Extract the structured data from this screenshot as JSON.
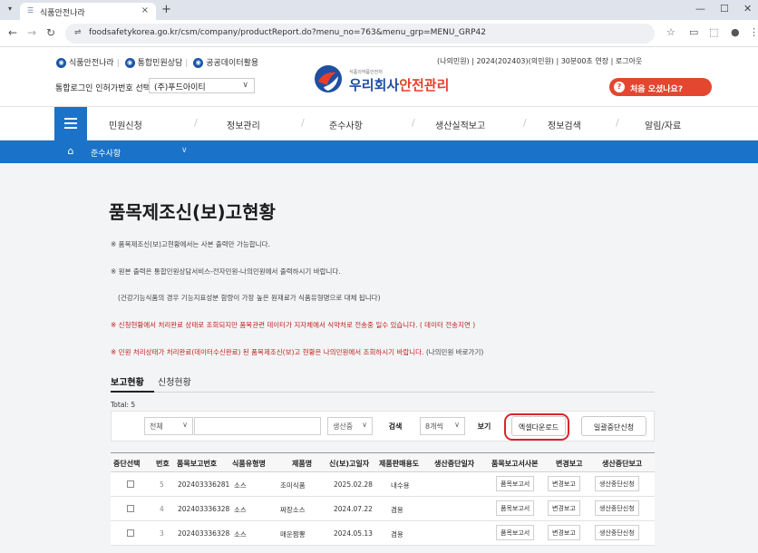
{
  "browser": {
    "tab_title": "식품안전나라",
    "tab_close": "×",
    "new_tab": "+",
    "menu_glyph": "▾",
    "url": "foodsafetykorea.go.kr/csm/company/productReport.do?menu_no=763&menu_grp=MENU_GRP42",
    "minimize": "—",
    "maximize": "☐",
    "close": "✕"
  },
  "header": {
    "quick_links": [
      "식품안전나라",
      "통합민원상담",
      "공공데이터활용"
    ],
    "login_label": "통합로그인 인허가번호 선택",
    "company": "(주)푸드아이티",
    "logo_small": "식품의약품안전처",
    "logo_main_a": "우리회사",
    "logo_main_b": "안전관리",
    "user_info": "(나의민원) | 2024(202403)(의민원) | 30분00초 연장 | 로그아웃",
    "help_button": "처음 오셨나요?"
  },
  "nav": {
    "items": [
      "민원신청",
      "정보관리",
      "준수사항",
      "생산실적보고",
      "정보검색",
      "알림/자료"
    ],
    "sub_label": "준수사항"
  },
  "page": {
    "title": "품목제조신(보)고현황",
    "notes": [
      "※ 품목제조신(보)고현황에서는 사본 출력만 가능합니다.",
      "※ 원본 출력은 통합민원상담서비스-전자민원-나의민원에서 출력하시기 바랍니다.",
      "(건강기능식품의 경우 기능지표성분 함량이 가장 높은 원재료가 식품유형명으로 대체 됩니다)",
      "※ 신청현황에서 처리완료 상태로 조회되지만 품목관련 데이터가 지자체에서 식약처로 전송중 일수 있습니다. ( 데이터 전송지연 )",
      "※ 민원 처리상태가 처리완료(데이터수신완료) 된 품목제조신(보)고 현황은 나의민원에서 조회하시기 바랍니다.",
      "(나의민원 바로가기)"
    ],
    "tab_active": "보고현황",
    "tab_inactive": "신청현황",
    "total": "Total: 5"
  },
  "filter": {
    "scope": "전체",
    "status": "생산중",
    "search_btn": "검색",
    "page_size": "8개씩",
    "view_btn": "보기",
    "excel_btn": "엑셀다운로드",
    "bulk_stop_btn": "일괄중단신청"
  },
  "table": {
    "headers": [
      "중단선택",
      "번호",
      "품목보고번호",
      "식품유형명",
      "제품명",
      "신(보)고일자",
      "제품판매용도",
      "생산중단일자",
      "품목보고서사본",
      "변경보고",
      "생산중단보고"
    ],
    "rows": [
      {
        "num": "5",
        "report_no": "202403336281",
        "food_type": "소스",
        "product": "조미식품",
        "date": "2025.02.28",
        "usage": "내수용",
        "stop_date": "",
        "copy": "품목보고서",
        "change": "변경보고",
        "stop": "생산중단신청"
      },
      {
        "num": "4",
        "report_no": "202403336328",
        "food_type": "소스",
        "product": "짜장소스",
        "date": "2024.07.22",
        "usage": "겸용",
        "stop_date": "",
        "copy": "품목보고서",
        "change": "변경보고",
        "stop": "생산중단신청"
      },
      {
        "num": "3",
        "report_no": "202403336328",
        "food_type": "소스",
        "product": "매운짬뽕",
        "date": "2024.05.13",
        "usage": "겸용",
        "stop_date": "",
        "copy": "품목보고서",
        "change": "변경보고",
        "stop": "생산중단신청"
      }
    ]
  },
  "colors": {
    "brand_blue": "#1a73c8",
    "accent_red": "#e4472f",
    "highlight": "#d8252b"
  }
}
